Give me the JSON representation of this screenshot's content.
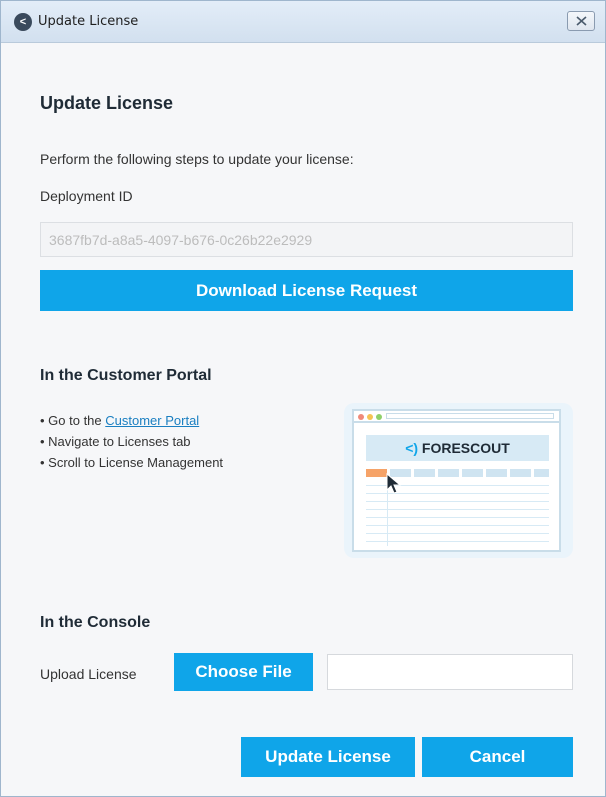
{
  "window": {
    "title": "Update License",
    "app_icon_glyph": "<"
  },
  "main": {
    "heading": "Update License",
    "steps_text": "Perform the following steps to update your license:",
    "deployment_label": "Deployment ID",
    "deployment_id": "3687fb7d-a8a5-4097-b676-0c26b22e2929",
    "download_button": "Download License Request"
  },
  "portal": {
    "heading": "In the Customer Portal",
    "bullet1_prefix": "• Go to the ",
    "bullet1_link": "Customer Portal",
    "bullet2": "• Navigate to Licenses tab",
    "bullet3": "• Scroll to License Management",
    "illustration": {
      "brand_chevron": "<)",
      "brand": "FORESCOUT"
    }
  },
  "console": {
    "heading": "In the Console",
    "upload_label": "Upload License",
    "choose_file_button": "Choose File",
    "file_value": ""
  },
  "footer": {
    "update_button": "Update License",
    "cancel_button": "Cancel"
  },
  "colors": {
    "accent": "#0fa5e9",
    "link": "#1a7fc1",
    "title_bar": "#d2e0ef"
  }
}
